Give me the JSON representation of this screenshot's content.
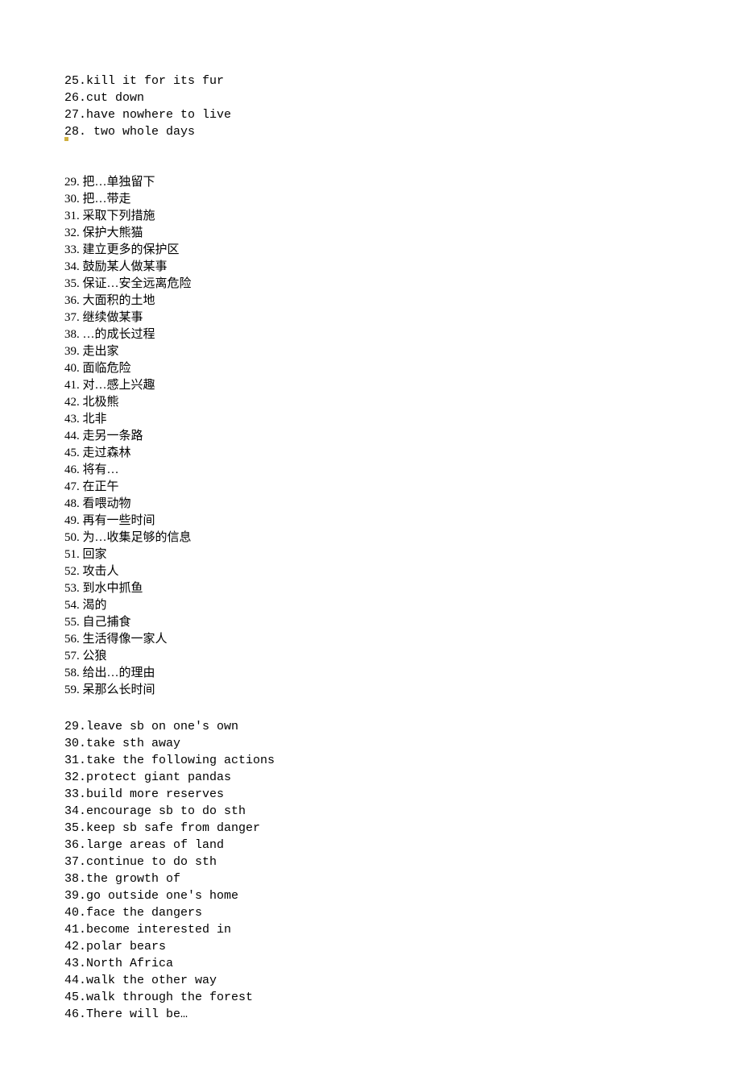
{
  "english_block_1": [
    "25.kill it for its fur",
    "26.cut down",
    "27.have nowhere to live",
    "28. two whole days"
  ],
  "chinese_block": [
    "29. 把…单独留下",
    "30. 把…带走",
    "31. 采取下列措施",
    "32. 保护大熊猫",
    "33. 建立更多的保护区",
    "34. 鼓励某人做某事",
    "35. 保证…安全远离危险",
    "36. 大面积的土地",
    "37. 继续做某事",
    "38. …的成长过程",
    "39. 走出家",
    "40. 面临危险",
    "41. 对…感上兴趣",
    "42. 北极熊",
    "43. 北非",
    "44. 走另一条路",
    "45. 走过森林",
    "46. 将有…",
    "47. 在正午",
    "48. 看喂动物",
    "49. 再有一些时间",
    "50. 为…收集足够的信息",
    "51. 回家",
    "52. 攻击人",
    "53. 到水中抓鱼",
    "54. 渴的",
    "55. 自己捕食",
    "56. 生活得像一家人",
    "57. 公狼",
    "58. 给出…的理由",
    "59. 呆那么长时间"
  ],
  "english_block_2": [
    "29.leave sb on one's own",
    "30.take sth away",
    "31.take the following actions",
    "32.protect giant pandas",
    "33.build more reserves",
    "34.encourage sb to do sth",
    "35.keep sb safe from danger",
    "36.large areas of land",
    "37.continue to do sth",
    "38.the growth of",
    "39.go outside one's home",
    "40.face the dangers",
    "41.become interested in",
    "42.polar bears",
    "43.North Africa",
    "44.walk the other way",
    "45.walk through the forest",
    "46.There will be…"
  ]
}
